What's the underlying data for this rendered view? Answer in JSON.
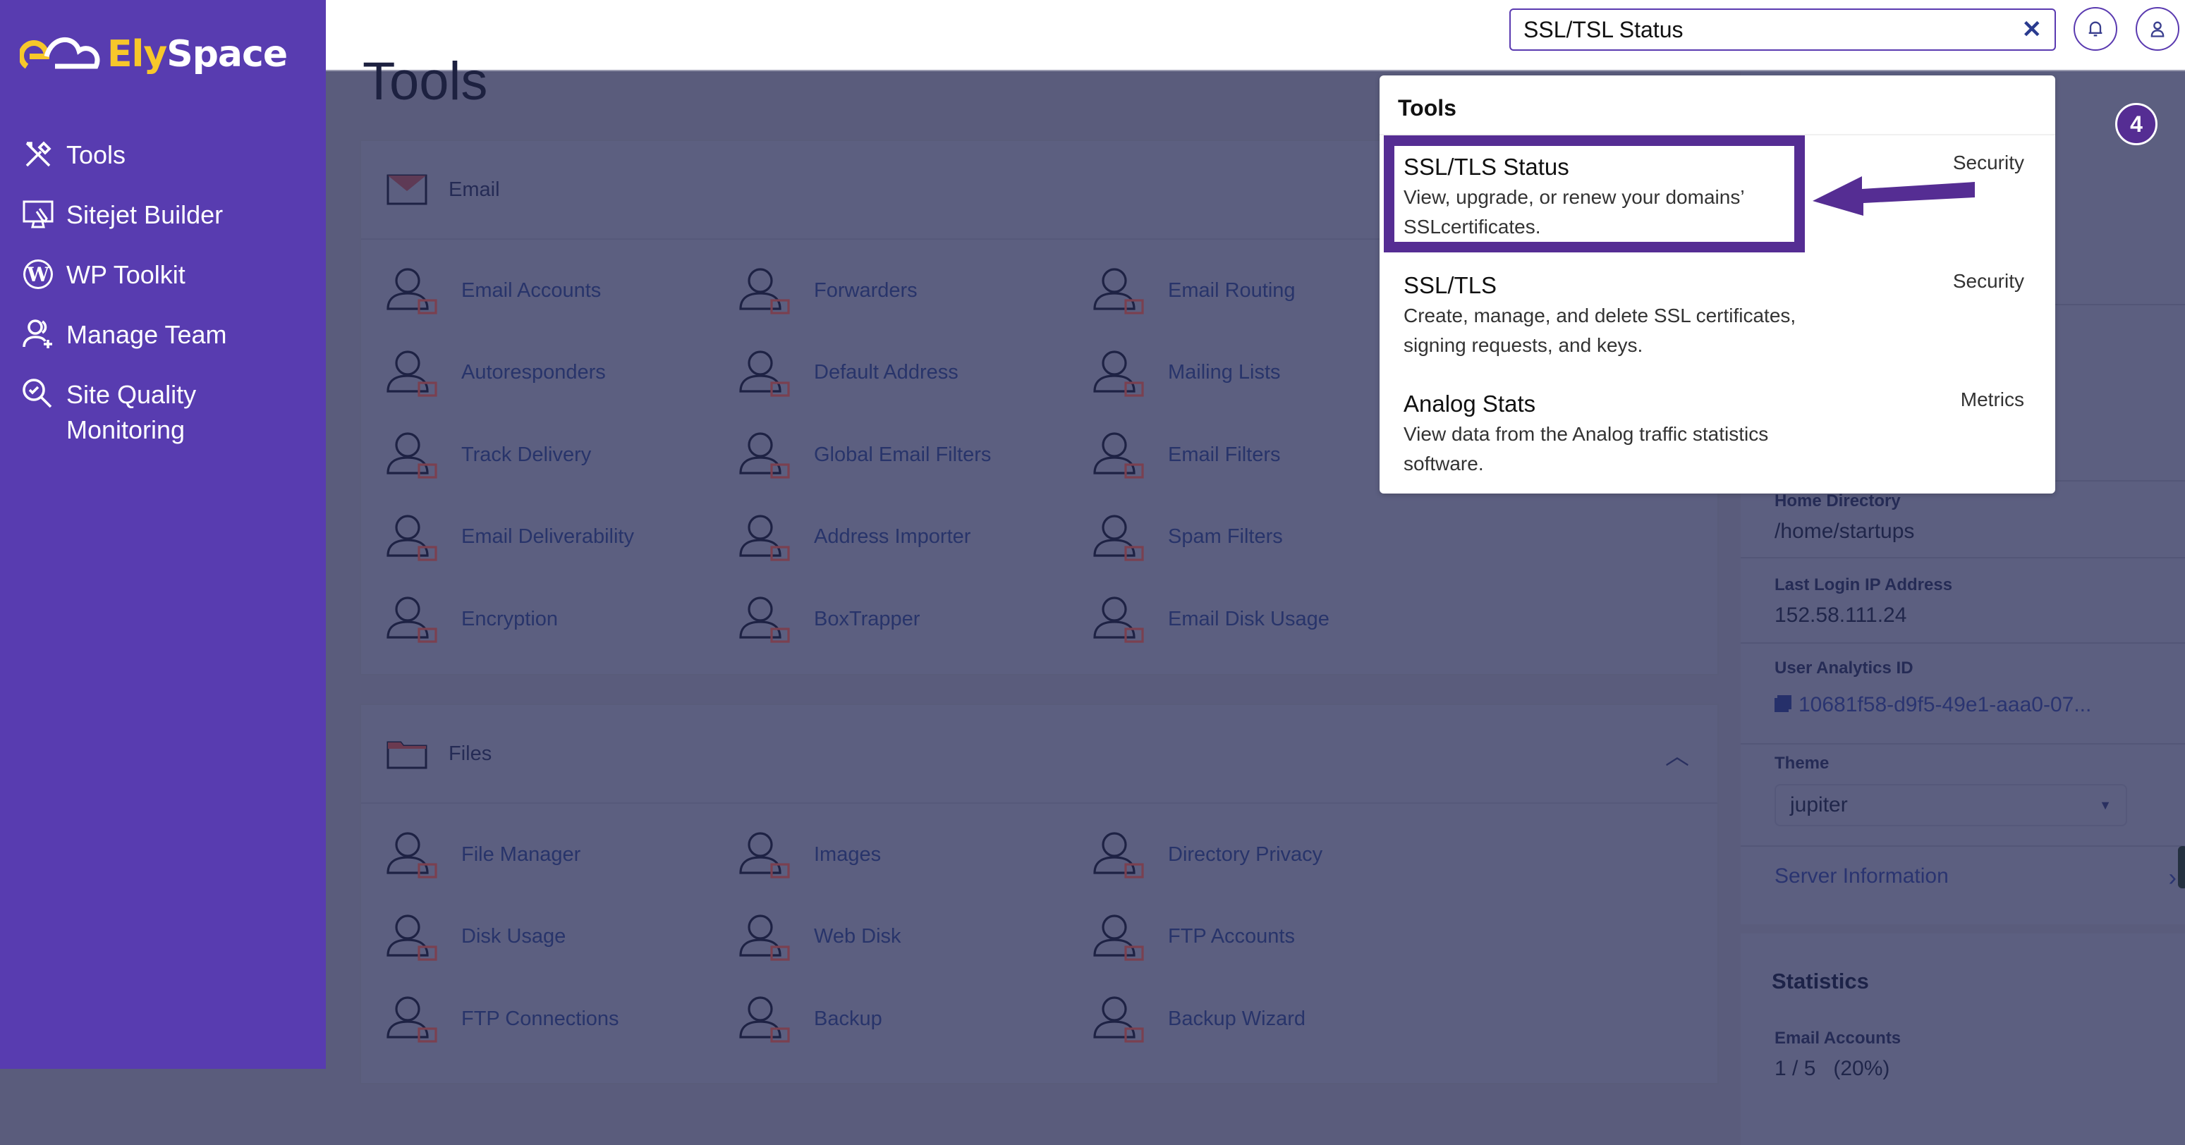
{
  "brand": {
    "logo_part1": "Ely",
    "logo_part2": "Space",
    "colors": {
      "sidebar": "#583cb0",
      "accent": "#552d93",
      "logo_yellow": "#f7c72a"
    }
  },
  "sidebar": {
    "items": [
      {
        "label": "Tools",
        "icon": "tools"
      },
      {
        "label": "Sitejet Builder",
        "icon": "monitor-pen"
      },
      {
        "label": "WP Toolkit",
        "icon": "wordpress"
      },
      {
        "label": "Manage Team",
        "icon": "user-plus"
      },
      {
        "label": "Site Quality Monitoring",
        "icon": "search-check"
      }
    ]
  },
  "header": {
    "search_value": "SSL/TSL Status",
    "clear_icon": "x",
    "bell_icon": "bell",
    "user_icon": "user"
  },
  "page": {
    "title": "Tools"
  },
  "email_section": {
    "title": "Email",
    "items": [
      {
        "label": "Email Accounts",
        "icon": "user-mail"
      },
      {
        "label": "Forwarders",
        "icon": "forward-arrow"
      },
      {
        "label": "Email Routing",
        "icon": "routing"
      },
      {
        "label": "Autoresponders",
        "icon": "refresh-mail"
      },
      {
        "label": "Default Address",
        "icon": "at-sign"
      },
      {
        "label": "Mailing Lists",
        "icon": "list-mail"
      },
      {
        "label": "Track Delivery",
        "icon": "pin-mail"
      },
      {
        "label": "Global Email Filters",
        "icon": "filter-globe"
      },
      {
        "label": "Email Filters",
        "icon": "filter"
      },
      {
        "label": "Email Deliverability",
        "icon": "mailbox"
      },
      {
        "label": "Address Importer",
        "icon": "at-import"
      },
      {
        "label": "Spam Filters",
        "icon": "filter-clock"
      },
      {
        "label": "Encryption",
        "icon": "lock-box"
      },
      {
        "label": "BoxTrapper",
        "icon": "box-trap"
      },
      {
        "label": "Email Disk Usage",
        "icon": "disk-pie"
      }
    ]
  },
  "files_section": {
    "title": "Files",
    "items": [
      {
        "label": "File Manager",
        "icon": "user-folder"
      },
      {
        "label": "Images",
        "icon": "image"
      },
      {
        "label": "Directory Privacy",
        "icon": "eye-folder"
      },
      {
        "label": "Disk Usage",
        "icon": "disk-pie"
      },
      {
        "label": "Web Disk",
        "icon": "disk"
      },
      {
        "label": "FTP Accounts",
        "icon": "user-ftp"
      },
      {
        "label": "FTP Connections",
        "icon": "network-ftp"
      },
      {
        "label": "Backup",
        "icon": "clock-backup"
      },
      {
        "label": "Backup Wizard",
        "icon": "clock-wand"
      }
    ]
  },
  "right_panel": {
    "home_directory_label": "Home Directory",
    "home_directory": "/home/startups",
    "last_ip_label": "Last Login IP Address",
    "last_ip": "152.58.111.24",
    "analytics_label": "User Analytics ID",
    "analytics_id": "10681f58-d9f5-49e1-aaa0-07...",
    "theme_label": "Theme",
    "theme_value": "jupiter",
    "server_info": "Server Information",
    "statistics_title": "Statistics",
    "email_accounts_label": "Email Accounts",
    "email_accounts_value": "1 / 5   (20%)"
  },
  "dropdown": {
    "title": "Tools",
    "results": [
      {
        "name": "SSL/TLS Status",
        "desc": "View, upgrade, or renew your domains’ SSLcertificates.",
        "category": "Security"
      },
      {
        "name": "SSL/TLS",
        "desc": "Create, manage, and delete SSL certificates, signing requests, and keys.",
        "category": "Security"
      },
      {
        "name": "Analog Stats",
        "desc": "View data from the Analog traffic statistics software.",
        "category": "Metrics"
      }
    ]
  },
  "annotation": {
    "step": "4"
  }
}
